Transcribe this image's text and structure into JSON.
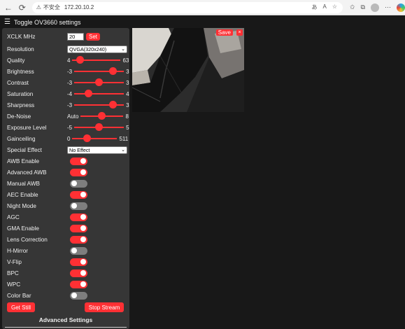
{
  "browser": {
    "back_icon": "arrow-left-icon",
    "refresh_icon": "refresh-icon",
    "security_label": "不安全",
    "url": "172.20.10.2",
    "tools": [
      "あ",
      "A",
      "☆"
    ]
  },
  "header": {
    "menu_symbol": "☰",
    "title": "Toggle OV3660 settings"
  },
  "xclk": {
    "label": "XCLK MHz",
    "value": "20",
    "button": "Set"
  },
  "resolution": {
    "label": "Resolution",
    "value": "QVGA(320x240)"
  },
  "sliders": [
    {
      "label": "Quality",
      "min": "4",
      "max": "63",
      "value": 10,
      "lo": 4,
      "hi": 63
    },
    {
      "label": "Brightness",
      "min": "-3",
      "max": "3",
      "value": 2,
      "lo": -3,
      "hi": 3
    },
    {
      "label": "Contrast",
      "min": "-3",
      "max": "3",
      "value": 0,
      "lo": -3,
      "hi": 3
    },
    {
      "label": "Saturation",
      "min": "-4",
      "max": "4",
      "value": -2,
      "lo": -4,
      "hi": 4
    },
    {
      "label": "Sharpness",
      "min": "-3",
      "max": "3",
      "value": 2,
      "lo": -3,
      "hi": 3
    },
    {
      "label": "De-Noise",
      "min": "Auto",
      "max": "8",
      "value": 4,
      "lo": 0,
      "hi": 8
    },
    {
      "label": "Exposure Level",
      "min": "-5",
      "max": "5",
      "value": 0,
      "lo": -5,
      "hi": 5
    },
    {
      "label": "Gainceiling",
      "min": "0",
      "max": "511",
      "value": 150,
      "lo": 0,
      "hi": 511
    }
  ],
  "special_effect": {
    "label": "Special Effect",
    "value": "No Effect"
  },
  "toggles": [
    {
      "label": "AWB Enable",
      "on": true
    },
    {
      "label": "Advanced AWB",
      "on": true
    },
    {
      "label": "Manual AWB",
      "on": false
    },
    {
      "label": "AEC Enable",
      "on": true
    },
    {
      "label": "Night Mode",
      "on": false
    },
    {
      "label": "AGC",
      "on": true
    },
    {
      "label": "GMA Enable",
      "on": true
    },
    {
      "label": "Lens Correction",
      "on": true
    },
    {
      "label": "H-Mirror",
      "on": false
    },
    {
      "label": "V-Flip",
      "on": true
    },
    {
      "label": "BPC",
      "on": true
    },
    {
      "label": "WPC",
      "on": true
    },
    {
      "label": "Color Bar",
      "on": false
    }
  ],
  "buttons": {
    "get_still": "Get Still",
    "stop_stream": "Stop Stream"
  },
  "advanced": {
    "title": "Advanced Settings"
  },
  "preview": {
    "save": "Save",
    "close": "×"
  },
  "colors": {
    "accent": "#ff3034",
    "panel": "#363636",
    "background": "#181818"
  }
}
